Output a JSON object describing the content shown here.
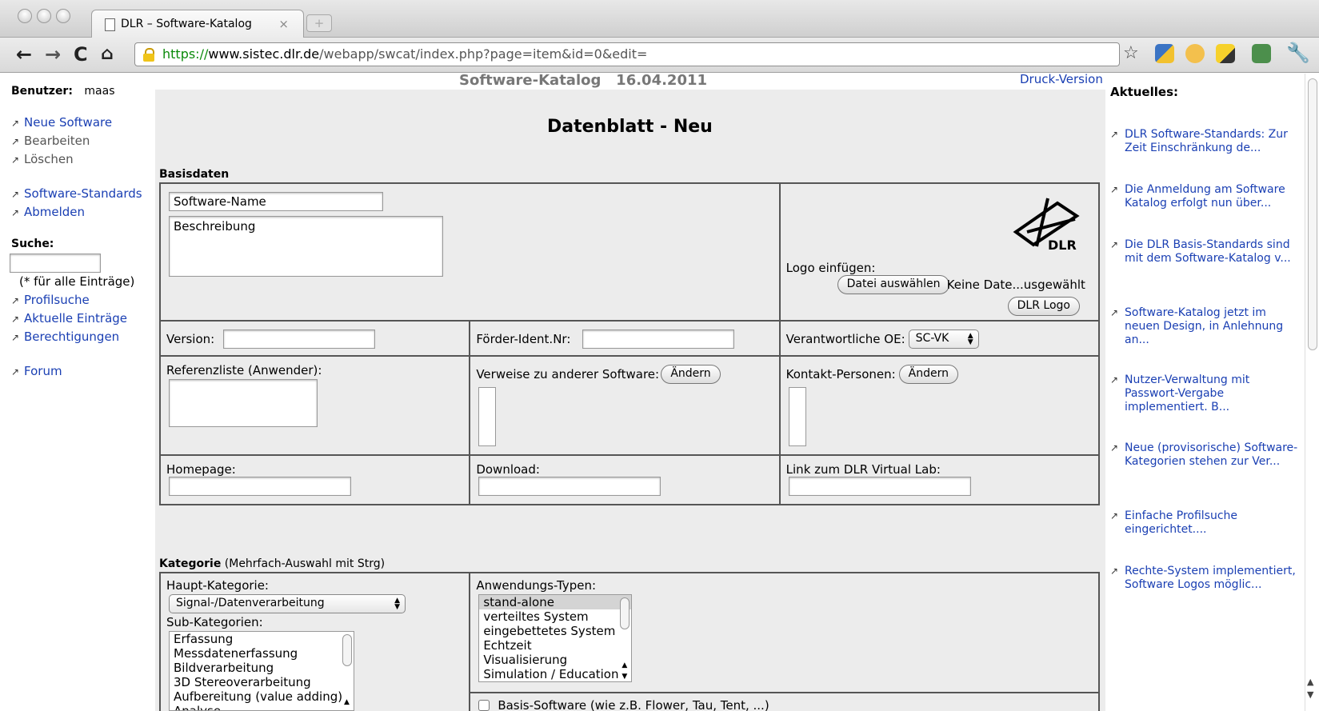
{
  "browser": {
    "tab_title": "DLR – Software-Katalog",
    "tab_close": "×",
    "url_scheme": "https://",
    "url_host": "www.sistec.dlr.de",
    "url_rest": "/webapp/swcat/index.php?page=item&id=0&edit="
  },
  "header": {
    "title": "Software-Katalog   16.04.2011",
    "print_link": "Druck-Version"
  },
  "sidebar": {
    "user_label": "Benutzer:",
    "user_name": "maas",
    "nav": [
      {
        "label": "Neue Software"
      },
      {
        "label": "Bearbeiten"
      },
      {
        "label": "Löschen"
      },
      {
        "label": "Software-Standards"
      },
      {
        "label": "Abmelden"
      }
    ],
    "search_label": "Suche:",
    "search_hint": "(* für alle Einträge)",
    "search_links": [
      {
        "label": "Profilsuche"
      },
      {
        "label": "Aktuelle Einträge"
      },
      {
        "label": "Berechtigungen"
      }
    ],
    "forum": "Forum"
  },
  "main": {
    "heading": "Datenblatt - Neu",
    "basisdaten_label": "Basisdaten",
    "software_name_value": "Software-Name",
    "beschreibung_value": "Beschreibung",
    "logo_label": "Logo einfügen:",
    "file_button": "Datei auswählen",
    "file_status": "Keine Date...usgewählt",
    "dlr_logo_button": "DLR Logo",
    "logo_text": "DLR",
    "version_label": "Version:",
    "foerder_label": "Förder-Ident.Nr:",
    "oe_label": "Verantwortliche OE:",
    "oe_value": "SC-VK",
    "referenz_label": "Referenzliste (Anwender):",
    "verweise_label": "Verweise zu anderer Software:",
    "kontakt_label": "Kontakt-Personen:",
    "aendern_label": "Ändern",
    "homepage_label": "Homepage:",
    "download_label": "Download:",
    "virtual_lab_label": "Link zum DLR Virtual Lab:",
    "kategorie_label": "Kategorie",
    "kategorie_hint": " (Mehrfach-Auswahl mit Strg)",
    "haupt_label": "Haupt-Kategorie:",
    "haupt_value": "Signal-/Datenverarbeitung",
    "sub_label": "Sub-Kategorien:",
    "sub_items": [
      "Erfassung",
      "Messdatenerfassung",
      "Bildverarbeitung",
      "3D Stereoverarbeitung",
      "Aufbereitung (value adding)",
      "Analyse"
    ],
    "anwendung_label": "Anwendungs-Typen:",
    "anwendung_items": [
      "stand-alone",
      "verteiltes System",
      "eingebettetes System",
      "Echtzeit",
      "Visualisierung",
      "Simulation / Education"
    ],
    "basis_software_label": "Basis-Software (wie z.B. Flower, Tau, Tent, ...)"
  },
  "news": {
    "heading": "Aktuelles:",
    "items": [
      "DLR Software-Standards: Zur Zeit Einschränkung de...",
      "Die Anmeldung am Software Katalog erfolgt nun über...",
      "Die DLR Basis-Standards sind mit dem Software-Katalog v...",
      "Software-Katalog jetzt im neuen Design, in Anlehnung an...",
      "Nutzer-Verwaltung mit Passwort-Vergabe implementiert. B...",
      "Neue (provisorische) Software-Kategorien stehen zur Ver...",
      "Einfache Profilsuche eingerichtet....",
      "Rechte-System implementiert, Software Logos möglic..."
    ]
  },
  "icons": {
    "back": "back-arrow-icon",
    "forward": "forward-arrow-icon",
    "reload": "reload-icon",
    "home": "home-icon",
    "lock": "lock-icon",
    "star": "bookmark-star-icon",
    "wrench": "wrench-icon"
  },
  "colors": {
    "link": "#1a3fb3",
    "url_scheme": "#0a8a0a",
    "form_bg": "#ececec"
  }
}
